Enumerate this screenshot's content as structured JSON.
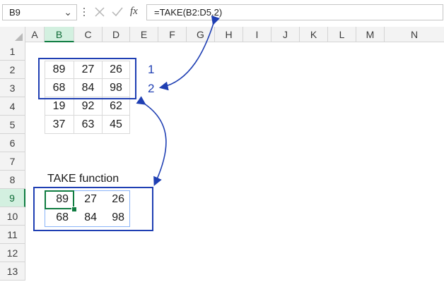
{
  "name_box": "B9",
  "formula": "=TAKE(B2:D5,2)",
  "fx_label": "fx",
  "columns": [
    "A",
    "B",
    "C",
    "D",
    "E",
    "F",
    "G",
    "H",
    "I",
    "J",
    "K",
    "L",
    "M",
    "N"
  ],
  "rows": [
    "1",
    "2",
    "3",
    "4",
    "5",
    "6",
    "7",
    "8",
    "9",
    "10",
    "11",
    "12",
    "13"
  ],
  "selected_cell": {
    "column": "B",
    "row": "9"
  },
  "source_table": [
    [
      "89",
      "27",
      "26"
    ],
    [
      "68",
      "84",
      "98"
    ],
    [
      "19",
      "92",
      "62"
    ],
    [
      "37",
      "63",
      "45"
    ]
  ],
  "annotations": [
    "1",
    "2"
  ],
  "section_label": "TAKE function",
  "result_table": [
    [
      "89",
      "27",
      "26"
    ],
    [
      "68",
      "84",
      "98"
    ]
  ],
  "colors": {
    "annotation": "#1f3fb3",
    "selection": "#107c41"
  }
}
